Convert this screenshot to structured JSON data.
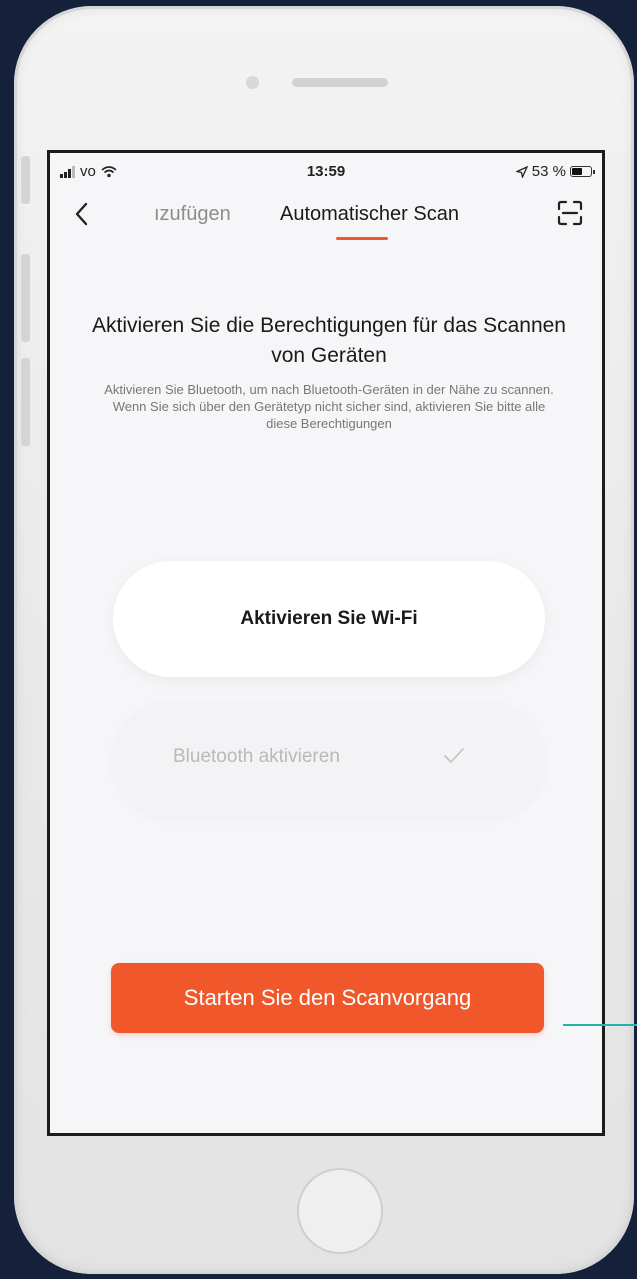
{
  "status_bar": {
    "carrier": "vo",
    "time": "13:59",
    "battery": "53 %",
    "battery_level": 0.53
  },
  "nav": {
    "tab_previous": "ızufügen",
    "tab_active": "Automatischer Scan"
  },
  "main": {
    "heading": "Aktivieren Sie die Berechtigungen für das Scannen von Geräten",
    "description": "Aktivieren Sie Bluetooth, um nach Bluetooth-Geräten in der Nähe zu scannen. Wenn Sie sich über den Gerätetyp nicht sicher sind, aktivieren Sie bitte alle diese Berechtigungen",
    "permissions": [
      {
        "label": "Aktivieren Sie Wi-Fi",
        "enabled": false
      },
      {
        "label": "Bluetooth aktivieren",
        "enabled": true
      }
    ],
    "start_button": "Starten Sie den Scanvorgang"
  },
  "colors": {
    "accent": "#f0582b",
    "background": "#15213a",
    "callout": "#1fb5a7"
  },
  "icons": [
    "back-chevron-icon",
    "scan-frame-icon",
    "checkmark-icon",
    "wifi-icon",
    "location-arrow-icon",
    "battery-icon"
  ]
}
